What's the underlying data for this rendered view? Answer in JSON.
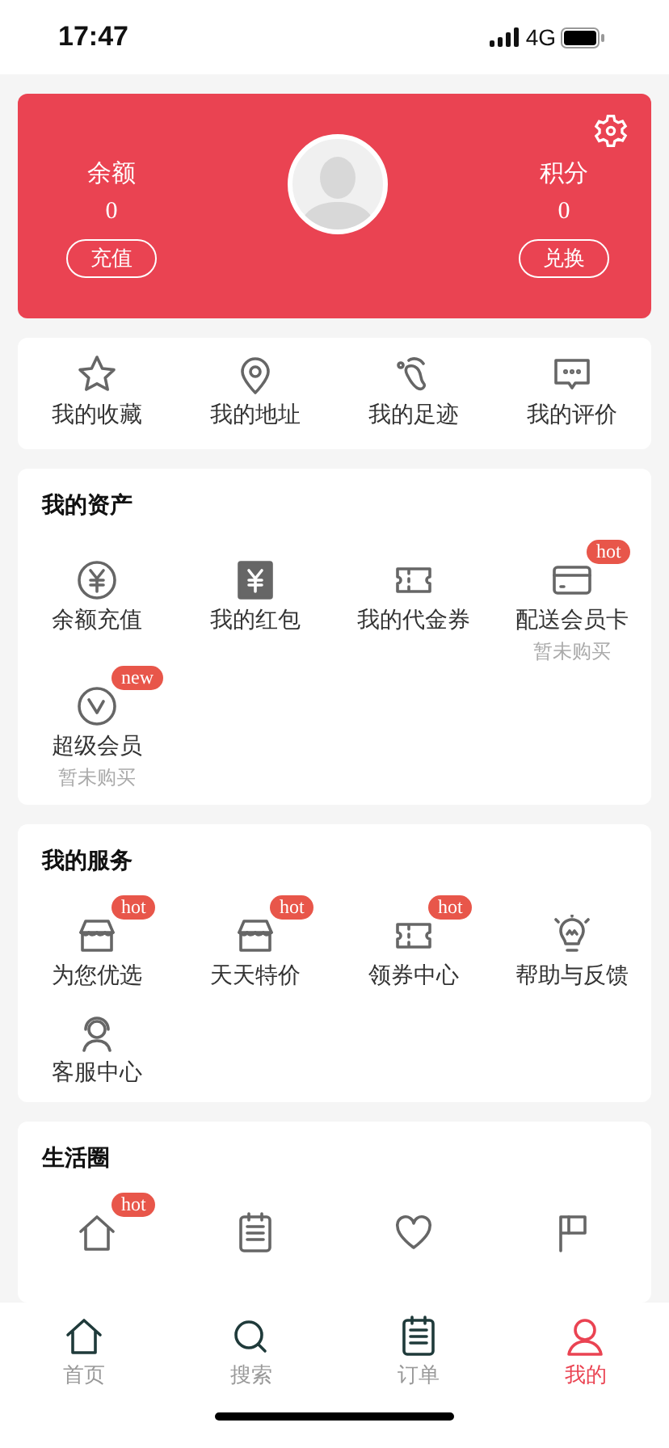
{
  "status_bar": {
    "time": "17:47",
    "network": "4G"
  },
  "profile": {
    "left": {
      "label": "余额",
      "value": "0",
      "button": "充值"
    },
    "right": {
      "label": "积分",
      "value": "0",
      "button": "兑换"
    }
  },
  "shortcuts": [
    {
      "label": "我的收藏"
    },
    {
      "label": "我的地址"
    },
    {
      "label": "我的足迹"
    },
    {
      "label": "我的评价"
    }
  ],
  "sections": [
    {
      "title": "我的资产",
      "items": [
        {
          "label": "余额充值"
        },
        {
          "label": "我的红包"
        },
        {
          "label": "我的代金券"
        },
        {
          "label": "配送会员卡",
          "badge": "hot",
          "note": "暂未购买"
        },
        {
          "label": "超级会员",
          "badge": "new",
          "note": "暂未购买"
        }
      ]
    },
    {
      "title": "我的服务",
      "items": [
        {
          "label": "为您优选",
          "badge": "hot"
        },
        {
          "label": "天天特价",
          "badge": "hot"
        },
        {
          "label": "领券中心",
          "badge": "hot"
        },
        {
          "label": "帮助与反馈"
        },
        {
          "label": "客服中心"
        }
      ]
    },
    {
      "title": "生活圈",
      "items": [
        {
          "kind": "icon_only",
          "badge": "hot"
        },
        {
          "kind": "icon_only"
        },
        {
          "kind": "icon_only"
        },
        {
          "kind": "icon_only"
        }
      ]
    }
  ],
  "tabs": [
    {
      "label": "首页",
      "selected": false
    },
    {
      "label": "搜索",
      "selected": false
    },
    {
      "label": "订单",
      "selected": false
    },
    {
      "label": "我的",
      "selected": true
    }
  ]
}
